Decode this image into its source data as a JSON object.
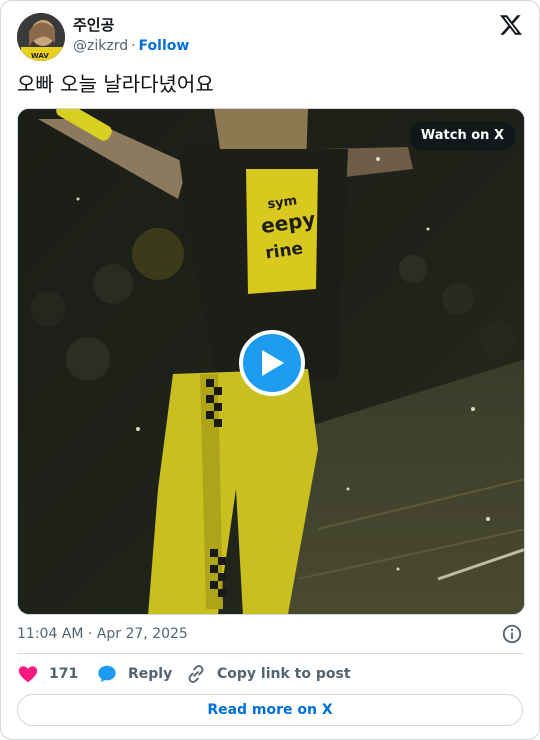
{
  "author": {
    "display_name": "주인공",
    "handle": "@zikzrd",
    "separator": "·",
    "follow_label": "Follow"
  },
  "tweet": {
    "text": "오빠 오늘 날라다녔어요"
  },
  "media": {
    "watch_label": "Watch on X",
    "shirt_text": [
      "sym",
      "eepy",
      "rine"
    ]
  },
  "meta": {
    "timestamp": "11:04 AM · Apr 27, 2025"
  },
  "actions": {
    "like_count": "171",
    "reply_label": "Reply",
    "copy_label": "Copy link to post"
  },
  "footer": {
    "read_more_label": "Read more on X"
  },
  "colors": {
    "accent": "#1d9bf0",
    "link": "#006fd6",
    "like": "#f91880",
    "text_secondary": "#536471",
    "border": "#cfd9de"
  },
  "icons": {
    "brand": "x-logo-icon",
    "play": "play-icon",
    "info": "info-icon",
    "like": "heart-icon",
    "reply": "speech-bubble-icon",
    "copy": "link-icon"
  }
}
